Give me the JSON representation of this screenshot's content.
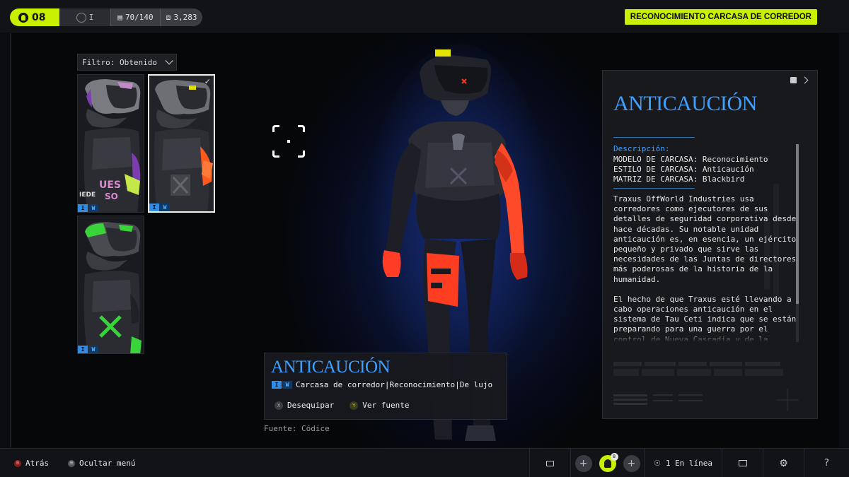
{
  "topbar": {
    "level": "08",
    "rank": "I",
    "inventory": "70/140",
    "credits": "3,283",
    "mode_badge": "RECONOCIMIENTO CARCASA DE CORREDOR"
  },
  "filter": {
    "label": "Filtro: Obtenido"
  },
  "skins": [
    {
      "name": "skin-purple",
      "tags": [
        "I",
        "W"
      ]
    },
    {
      "name": "skin-orange-selected",
      "tags": [
        "I",
        "W"
      ],
      "selected": true
    },
    {
      "name": "skin-green",
      "tags": [
        "I",
        "W"
      ]
    }
  ],
  "info": {
    "name": "ANTICAUCIÓN",
    "tags": [
      "I",
      "W"
    ],
    "subtitle": "Carcasa de corredor|Reconocimiento|De lujo",
    "action_unequip": "Desequipar",
    "action_source": "Ver fuente",
    "pad_x": "X",
    "pad_y": "Y",
    "source": "Fuente: Códice"
  },
  "panel": {
    "title": "ANTICAUCIÓN",
    "desc_label": "Descripción:",
    "meta": [
      "MODELO DE CARCASA: Reconocimiento",
      "ESTILO DE CARCASA: Anticaución",
      "MATRIZ DE CARCASA: Blackbird"
    ],
    "paragraphs": [
      "Traxus OffWorld Industries usa corredores como ejecutores de sus detalles de seguridad corporativa desde hace décadas. Su notable unidad anticaución es, en esencia, un ejército pequeño y privado que sirve las necesidades de las Juntas de directores más poderosas de la historia de la humanidad.",
      "El hecho de que Traxus esté llevando a cabo operaciones anticaución en el sistema de Tau Ceti indica que se están preparando para una guerra por el control de Nueva Cascadia y de la Marathon. Malas noticias para sus"
    ]
  },
  "bottombar": {
    "back_label": "Atrás",
    "back_key": "B",
    "hide_menu_label": "Ocultar menú",
    "online_label": "1 En línea",
    "player_level": "8"
  },
  "colors": {
    "accent_lime": "#c8f000",
    "accent_blue": "#3fa0ff",
    "tag_blue": "#2f8de8"
  }
}
